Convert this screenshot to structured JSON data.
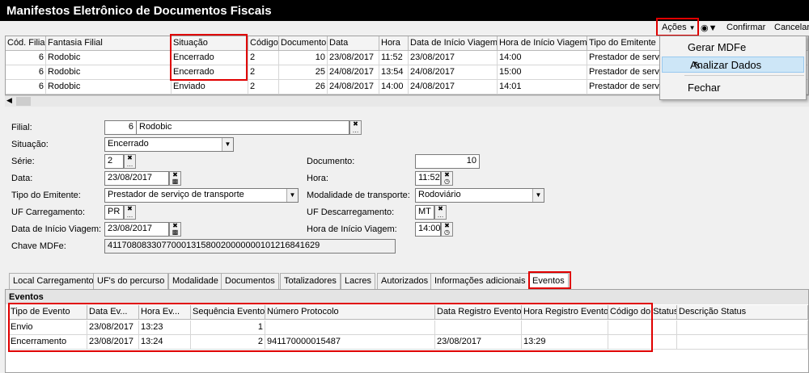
{
  "window": {
    "title": "Manifestos Eletrônico de Documentos Fiscais"
  },
  "toolbar": {
    "acoes": "Ações",
    "confirmar": "Confirmar",
    "cancelar": "Cancelar"
  },
  "actions_menu": {
    "items": [
      "Gerar MDFe",
      "Analizar Dados",
      "Fechar"
    ]
  },
  "top_grid": {
    "columns": [
      "Cód. Filial",
      "Fantasia Filial",
      "Situação",
      "Código",
      "Documento",
      "Data",
      "Hora",
      "Data de Início Viagem",
      "Hora de Início Viagem",
      "Tipo do Emitente"
    ],
    "rows": [
      [
        "6",
        "Rodobic",
        "Encerrado",
        "2",
        "10",
        "23/08/2017",
        "11:52",
        "23/08/2017",
        "14:00",
        "Prestador de servi"
      ],
      [
        "6",
        "Rodobic",
        "Encerrado",
        "2",
        "25",
        "24/08/2017",
        "13:54",
        "24/08/2017",
        "15:00",
        "Prestador de servi"
      ],
      [
        "6",
        "Rodobic",
        "Enviado",
        "2",
        "26",
        "24/08/2017",
        "14:00",
        "24/08/2017",
        "14:01",
        "Prestador de servi"
      ]
    ]
  },
  "form": {
    "filial_label": "Filial:",
    "filial_code": "6",
    "filial_name": "Rodobic",
    "situacao_label": "Situação:",
    "situacao_value": "Encerrado",
    "serie_label": "Série:",
    "serie_value": "2",
    "documento_label": "Documento:",
    "documento_value": "10",
    "data_label": "Data:",
    "data_value": "23/08/2017",
    "hora_label": "Hora:",
    "hora_value": "11:52",
    "tipo_emitente_label": "Tipo do Emitente:",
    "tipo_emitente_value": "Prestador de serviço de transporte",
    "modalidade_label": "Modalidade de transporte:",
    "modalidade_value": "Rodoviário",
    "uf_carregamento_label": "UF Carregamento:",
    "uf_carregamento_value": "PR",
    "uf_descarregamento_label": "UF Descarregamento:",
    "uf_descarregamento_value": "MT",
    "data_inicio_label": "Data de Início Viagem:",
    "data_inicio_value": "23/08/2017",
    "hora_inicio_label": "Hora de Início Viagem:",
    "hora_inicio_value": "14:00",
    "chave_label": "Chave MDFe:",
    "chave_value": "41170808330770001315800200000001012168416‍29"
  },
  "tabs": [
    "Local Carregamento",
    "UF's do percurso",
    "Modalidade",
    "Documentos",
    "Totalizadores",
    "Lacres",
    "Autorizados",
    "Informações adicionais",
    "Eventos"
  ],
  "events": {
    "title": "Eventos",
    "columns": [
      "Tipo de Evento",
      "Data Ev...",
      "Hora Ev...",
      "Sequência Evento",
      "Número Protocolo",
      "Data Registro Evento",
      "Hora Registro Evento",
      "Código do Status",
      "Descrição Status"
    ],
    "rows": [
      [
        "Envio",
        "23/08/2017",
        "13:23",
        "1",
        "",
        "",
        "",
        "",
        ""
      ],
      [
        "Encerramento",
        "23/08/2017",
        "13:24",
        "2",
        "941170000015487",
        "23/08/2017",
        "13:29",
        "",
        ""
      ]
    ]
  }
}
